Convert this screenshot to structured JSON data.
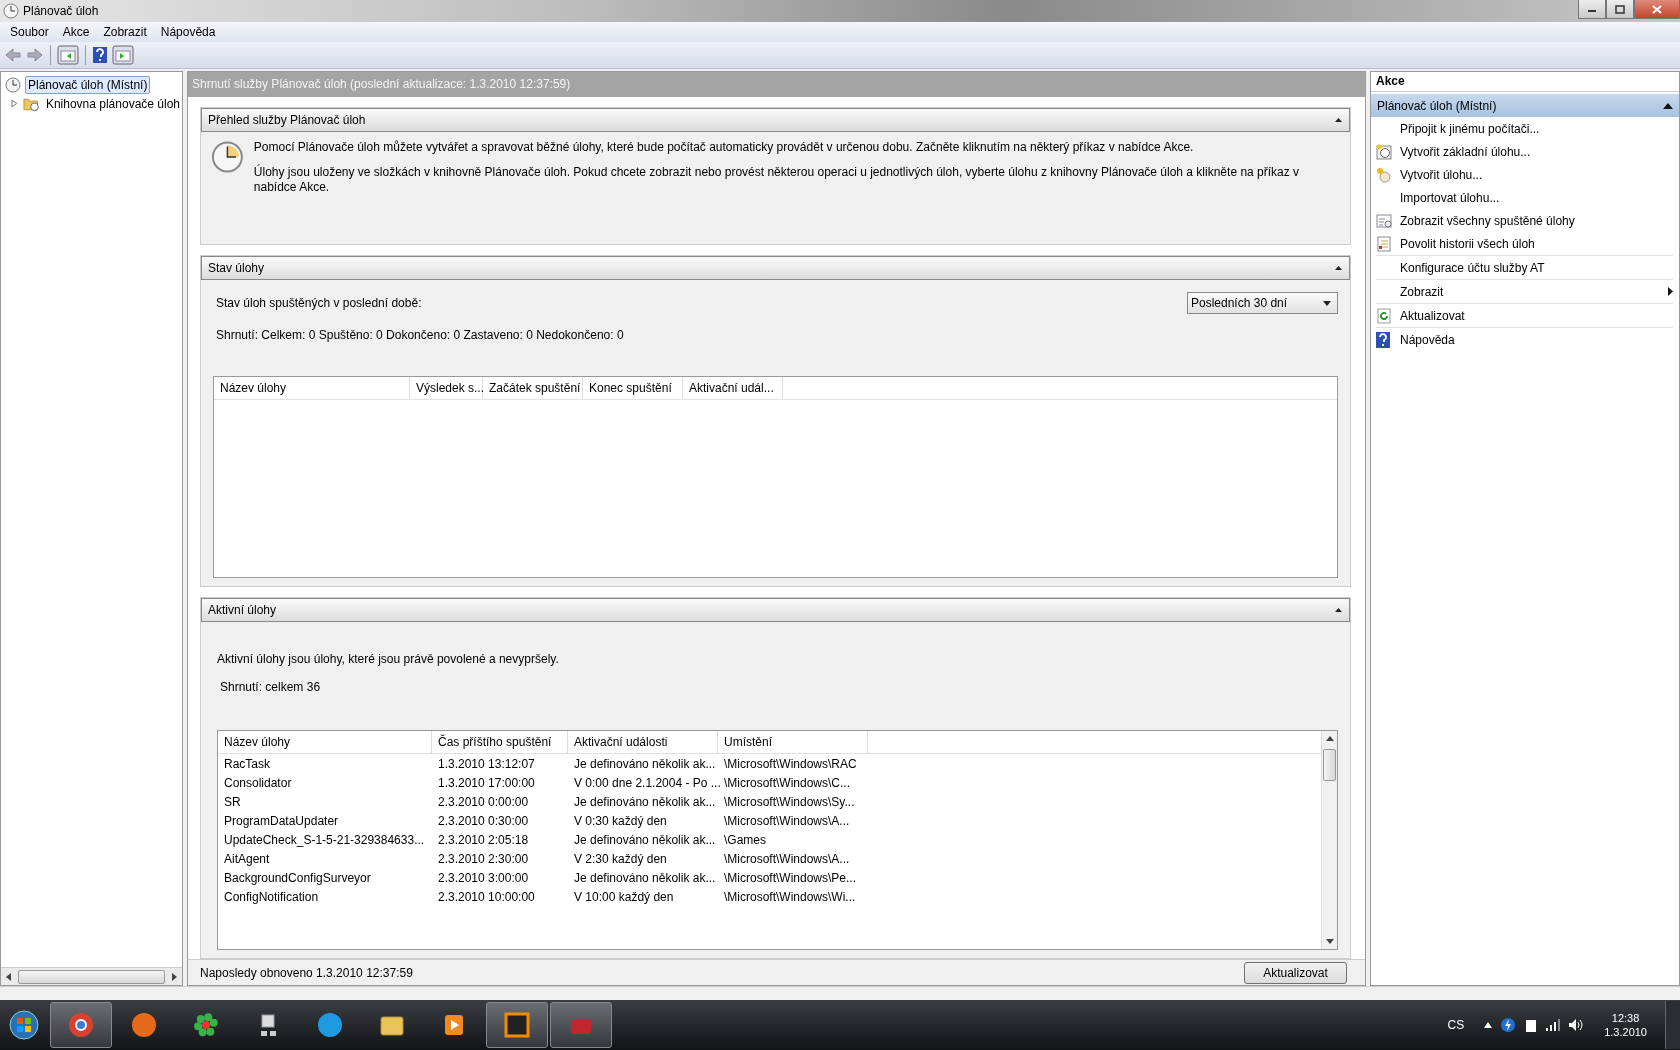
{
  "window": {
    "title": "Plánovač úloh"
  },
  "menu": [
    "Soubor",
    "Akce",
    "Zobrazit",
    "Nápověda"
  ],
  "tree": [
    {
      "label": "Plánovač úloh (Místní)",
      "selected": true
    },
    {
      "label": "Knihovna plánovače úloh",
      "selected": false,
      "expanded": false
    }
  ],
  "center": {
    "header": "Shrnutí služby Plánovač úloh (poslední aktualizace: 1.3.2010 12:37:59)",
    "overview": {
      "title": "Přehled služby Plánovač úloh",
      "expanded": true,
      "paragraphs": [
        "Pomocí Plánovače úloh můžete vytvářet a spravovat běžné úlohy, které bude počítač automaticky provádět v určenou dobu. Začněte kliknutím na některý příkaz v nabídce Akce.",
        "Úlohy jsou uloženy ve složkách v knihovně Plánovače úloh. Pokud chcete zobrazit nebo provést některou operaci u jednotlivých úloh, vyberte úlohu z knihovny Plánovače úloh a klikněte na příkaz v nabídce Akce."
      ]
    },
    "status": {
      "title": "Stav úlohy",
      "expanded": true,
      "label": "Stav úloh spuštěných v poslední době:",
      "period": "Posledních 30 dní",
      "summary": "Shrnutí: Celkem: 0 Spuštěno: 0 Dokončeno: 0 Zastaveno: 0 Nedokončeno: 0",
      "columns": [
        "Název úlohy",
        "Výsledek s...",
        "Začátek spuštění",
        "Konec spuštění",
        "Aktivační udál..."
      ]
    },
    "active": {
      "title": "Aktivní úlohy",
      "expanded": true,
      "description": "Aktivní úlohy jsou úlohy, které jsou právě povolené a nevypršely.",
      "summary": "Shrnutí: celkem 36",
      "columns": [
        "Název úlohy",
        "Čas příštího spuštění",
        "Aktivační události",
        "Umístění"
      ],
      "rows": [
        [
          "RacTask",
          "1.3.2010 13:12:07",
          "Je definováno několik ak...",
          "\\Microsoft\\Windows\\RAC"
        ],
        [
          "Consolidator",
          "1.3.2010 17:00:00",
          "V 0:00 dne 2.1.2004 - Po ...",
          "\\Microsoft\\Windows\\C..."
        ],
        [
          "SR",
          "2.3.2010 0:00:00",
          "Je definováno několik ak...",
          "\\Microsoft\\Windows\\Sy..."
        ],
        [
          "ProgramDataUpdater",
          "2.3.2010 0:30:00",
          "V 0:30 každý den",
          "\\Microsoft\\Windows\\A..."
        ],
        [
          "UpdateCheck_S-1-5-21-329384633...",
          "2.3.2010 2:05:18",
          "Je definováno několik ak...",
          "\\Games"
        ],
        [
          "AitAgent",
          "2.3.2010 2:30:00",
          "V 2:30 každý den",
          "\\Microsoft\\Windows\\A..."
        ],
        [
          "BackgroundConfigSurveyor",
          "2.3.2010 3:00:00",
          "Je definováno několik ak...",
          "\\Microsoft\\Windows\\Pe..."
        ],
        [
          "ConfigNotification",
          "2.3.2010 10:00:00",
          "V 10:00 každý den",
          "\\Microsoft\\Windows\\Wi..."
        ]
      ]
    },
    "footer": {
      "text": "Naposledy obnoveno 1.3.2010 12:37:59",
      "button": "Aktualizovat"
    }
  },
  "actions": {
    "title": "Akce",
    "group": {
      "title": "Plánovač úloh (Místní)",
      "expanded": true
    },
    "items": [
      {
        "label": "Připojit k jinému počítači...",
        "kind": "plain",
        "separator_after": false
      },
      {
        "label": "Vytvořit základní úlohu...",
        "kind": "create-basic",
        "separator_after": false
      },
      {
        "label": "Vytvořit úlohu...",
        "kind": "create",
        "separator_after": false
      },
      {
        "label": "Importovat úlohu...",
        "kind": "plain",
        "separator_after": false
      },
      {
        "label": "Zobrazit všechny spuštěné úlohy",
        "kind": "list",
        "separator_after": false
      },
      {
        "label": "Povolit historii všech úloh",
        "kind": "history",
        "separator_after": true
      },
      {
        "label": "Konfigurace účtu služby AT",
        "kind": "plain",
        "separator_after": true
      },
      {
        "label": "Zobrazit",
        "kind": "submenu",
        "separator_after": true
      },
      {
        "label": "Aktualizovat",
        "kind": "refresh",
        "separator_after": true
      },
      {
        "label": "Nápověda",
        "kind": "help",
        "separator_after": false
      }
    ]
  },
  "taskbar": {
    "apps": [
      {
        "kind": "browser",
        "running": true
      },
      {
        "kind": "fox",
        "running": false
      },
      {
        "kind": "flower",
        "running": false
      },
      {
        "kind": "network",
        "running": false
      },
      {
        "kind": "chat",
        "running": false
      },
      {
        "kind": "folder",
        "running": false
      },
      {
        "kind": "media",
        "running": false
      },
      {
        "kind": "game",
        "running": true
      },
      {
        "kind": "toolbox",
        "running": true
      }
    ],
    "language": "CS",
    "time": "12:38",
    "date": "1.3.2010"
  }
}
